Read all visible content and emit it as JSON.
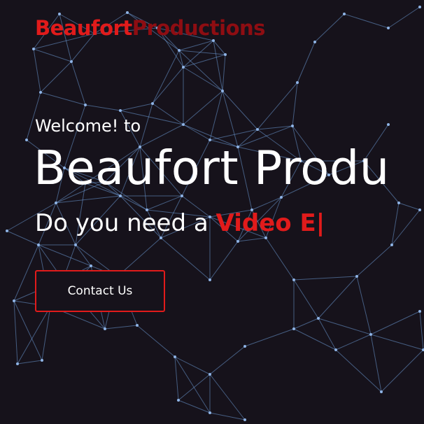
{
  "header": {
    "logo_part_1": "Beaufort",
    "logo_part_2": "Productions"
  },
  "hero": {
    "welcome": "Welcome! to",
    "title": "Beaufort Produ",
    "tagline_prefix": "Do you need a",
    "tagline_highlight": "Video E|",
    "contact_label": "Contact Us"
  },
  "colors": {
    "background": "#16121b",
    "accent": "#e11b1b",
    "accent_dark": "#8e0d12",
    "network_lines": "#6e9bd6",
    "text": "#ffffff"
  }
}
